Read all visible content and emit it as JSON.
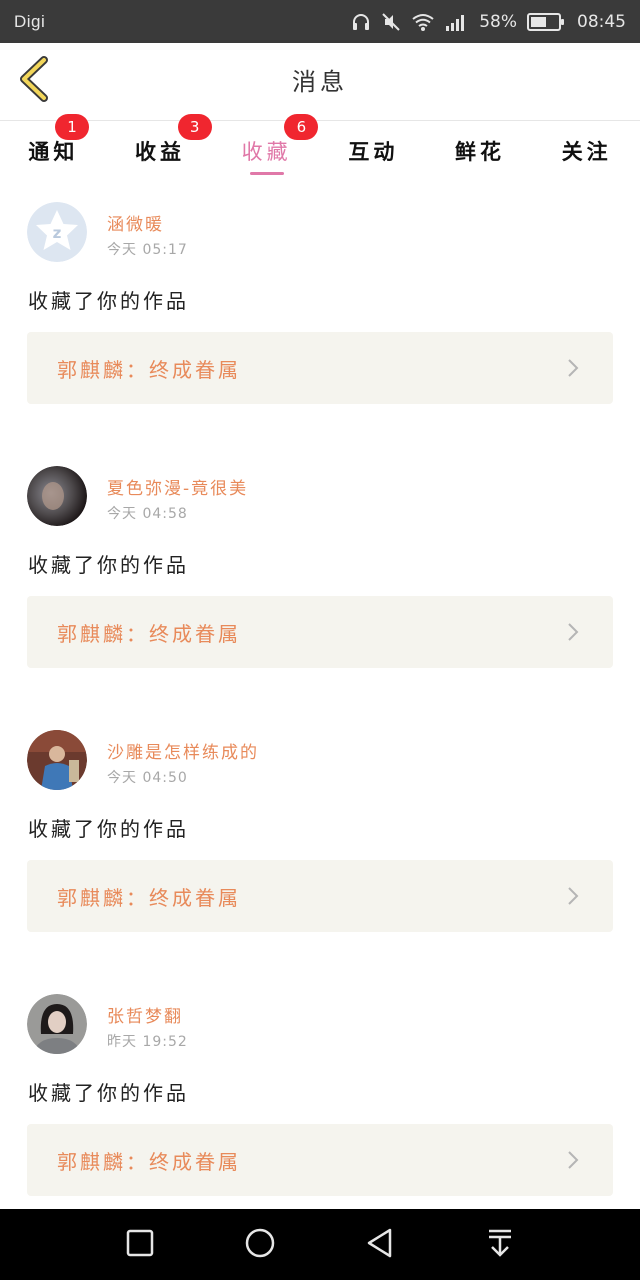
{
  "status_bar": {
    "carrier": "Digi",
    "battery_percent": "58%",
    "battery_level": 0.58,
    "time": "08:45"
  },
  "header": {
    "title": "消息"
  },
  "tabs": [
    {
      "label": "通知",
      "badge": "1",
      "active": false
    },
    {
      "label": "收益",
      "badge": "3",
      "active": false
    },
    {
      "label": "收藏",
      "badge": "6",
      "active": true
    },
    {
      "label": "互动",
      "badge": "",
      "active": false
    },
    {
      "label": "鲜花",
      "badge": "",
      "active": false
    },
    {
      "label": "关注",
      "badge": "",
      "active": false
    }
  ],
  "items": [
    {
      "username": "涵微暖",
      "time": "今天 05:17",
      "action": "收藏了你的作品",
      "work_title": "郭麒麟：终成眷属",
      "avatar": "default-avatar-icon"
    },
    {
      "username": "夏色弥漫-竟很美",
      "time": "今天 04:58",
      "action": "收藏了你的作品",
      "work_title": "郭麒麟：终成眷属",
      "avatar": "user-photo"
    },
    {
      "username": "沙雕是怎样练成的",
      "time": "今天 04:50",
      "action": "收藏了你的作品",
      "work_title": "郭麒麟：终成眷属",
      "avatar": "user-photo"
    },
    {
      "username": "张哲梦翻",
      "time": "昨天 19:52",
      "action": "收藏了你的作品",
      "work_title": "郭麒麟：终成眷属",
      "avatar": "user-photo"
    }
  ],
  "colors": {
    "accent": "#e078a8",
    "username": "#e88a5a",
    "badge": "#f0262f",
    "card_bg": "#f5f4ee"
  }
}
